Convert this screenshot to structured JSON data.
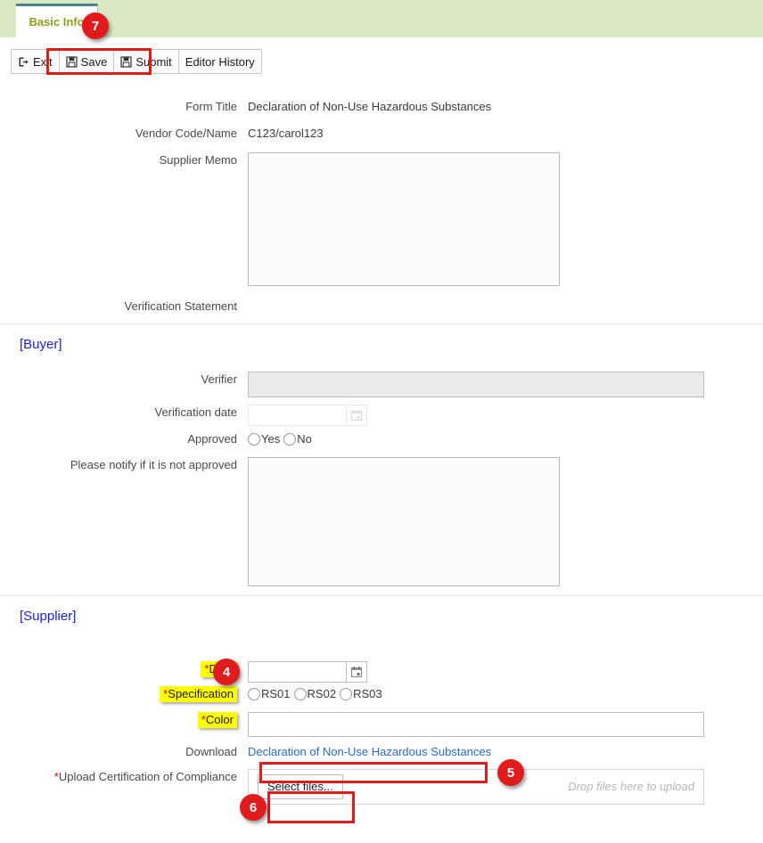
{
  "tab": {
    "label": "Basic Info"
  },
  "toolbar": {
    "exit": "Exit",
    "save": "Save",
    "submit": "Submit",
    "editor_history": "Editor History"
  },
  "basic": {
    "form_title_label": "Form Title",
    "form_title_value": "Declaration of Non-Use Hazardous Substances",
    "vendor_label": "Vendor Code/Name",
    "vendor_value": "C123/carol123",
    "supplier_memo_label": "Supplier Memo",
    "supplier_memo_value": "",
    "verification_statement_label": "Verification Statement"
  },
  "buyer": {
    "heading": "[Buyer]",
    "verifier_label": "Verifier",
    "verifier_value": "",
    "verification_date_label": "Verification date",
    "verification_date_value": "",
    "approved_label": "Approved",
    "approved_yes": "Yes",
    "approved_no": "No",
    "notify_label": "Please notify if it is not approved",
    "notify_value": ""
  },
  "supplier": {
    "heading": "[Supplier]",
    "date_label": "Date",
    "date_value": "",
    "specification_label": "Specification",
    "spec_options": [
      "RS01",
      "RS02",
      "RS03"
    ],
    "color_label": "Color",
    "color_value": "",
    "download_label": "Download",
    "download_link": "Declaration of Non-Use Hazardous Substances",
    "upload_label": "Upload Certification of Compliance",
    "select_files": "Select files...",
    "drop_hint": "Drop files here to upload",
    "required_mark": "*"
  },
  "annotations": {
    "badge4": "4",
    "badge5": "5",
    "badge6": "6",
    "badge7": "7"
  },
  "colors": {
    "tab_bar": "#d9e8c4",
    "tab_text": "#8fa01e",
    "tab_border": "#4a7f8c",
    "section_heading": "#2020dd",
    "link": "#2a6ebb",
    "annotation": "#e01b1b",
    "highlight": "#ffff00"
  }
}
